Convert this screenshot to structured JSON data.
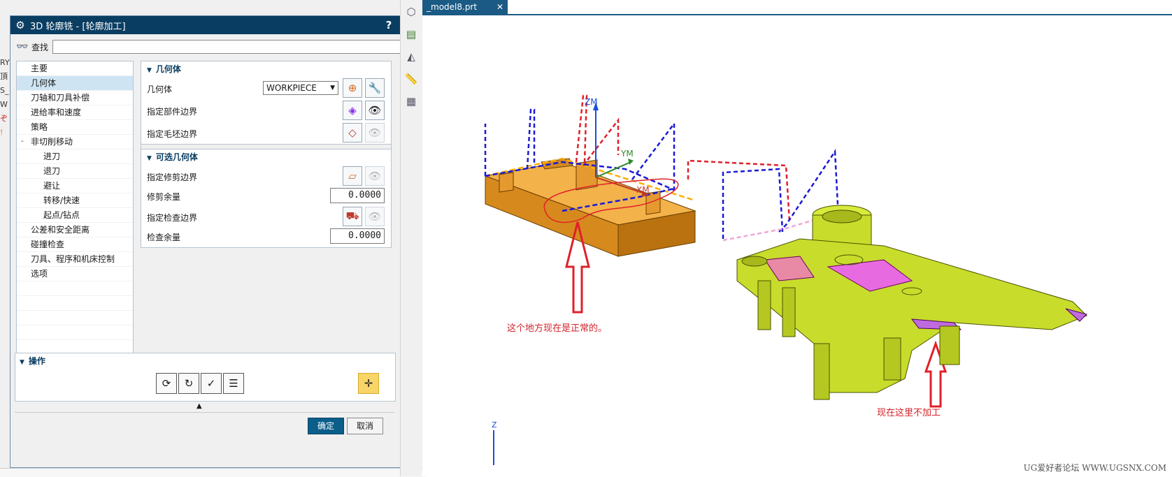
{
  "background": {
    "left_strip_fragments": [
      "RY",
      "頂",
      "S_",
      "W",
      "ぞ",
      "!"
    ]
  },
  "dialog": {
    "title": "3D 轮廓铣 - [轮廓加工]",
    "help_button": "?",
    "close_button": "✕",
    "search_label": "查找",
    "search_value": "",
    "tree": [
      {
        "label": "主要",
        "indent": 1,
        "selected": false
      },
      {
        "label": "几何体",
        "indent": 1,
        "selected": true
      },
      {
        "label": "刀轴和刀具补偿",
        "indent": 1,
        "selected": false
      },
      {
        "label": "进给率和速度",
        "indent": 1,
        "selected": false
      },
      {
        "label": "策略",
        "indent": 1,
        "selected": false
      },
      {
        "label": "非切削移动",
        "indent": 1,
        "selected": false,
        "expander": "-"
      },
      {
        "label": "进刀",
        "indent": 2,
        "selected": false
      },
      {
        "label": "退刀",
        "indent": 2,
        "selected": false
      },
      {
        "label": "避让",
        "indent": 2,
        "selected": false
      },
      {
        "label": "转移/快速",
        "indent": 2,
        "selected": false
      },
      {
        "label": "起点/钻点",
        "indent": 2,
        "selected": false
      },
      {
        "label": "公差和安全距离",
        "indent": 1,
        "selected": false
      },
      {
        "label": "碰撞检查",
        "indent": 1,
        "selected": false
      },
      {
        "label": "刀具、程序和机床控制",
        "indent": 1,
        "selected": false
      },
      {
        "label": "选项",
        "indent": 1,
        "selected": false
      }
    ],
    "geometry_section": {
      "header": "几何体",
      "geometry_label": "几何体",
      "geometry_value": "WORKPIECE",
      "part_boundary_label": "指定部件边界",
      "blank_boundary_label": "指定毛坯边界"
    },
    "optional_section": {
      "header": "可选几何体",
      "trim_boundary_label": "指定修剪边界",
      "trim_stock_label": "修剪余量",
      "trim_stock_value": "0.0000",
      "check_boundary_label": "指定检查边界",
      "check_stock_label": "检查余量",
      "check_stock_value": "0.0000"
    },
    "operations": {
      "header": "操作"
    },
    "ok_label": "确定",
    "cancel_label": "取消"
  },
  "graphics": {
    "tab_label": "_model8.prt",
    "axes": {
      "zm": "ZM",
      "ym": "YM",
      "xm": "XM",
      "z": "Z"
    },
    "annotation_normal": "这个地方现在是正常的。",
    "annotation_not_machined": "现在这里不加工",
    "watermark": "UG爱好者论坛 WWW.UGSNX.COM"
  },
  "colors": {
    "title_bar": "#0a3d62",
    "tab": "#1b5a85",
    "annotation_red": "#d4232a",
    "block_orange": "#e59a2f",
    "part_green": "#c8dc2c",
    "toolpath_blue": "#1a1ad6"
  }
}
